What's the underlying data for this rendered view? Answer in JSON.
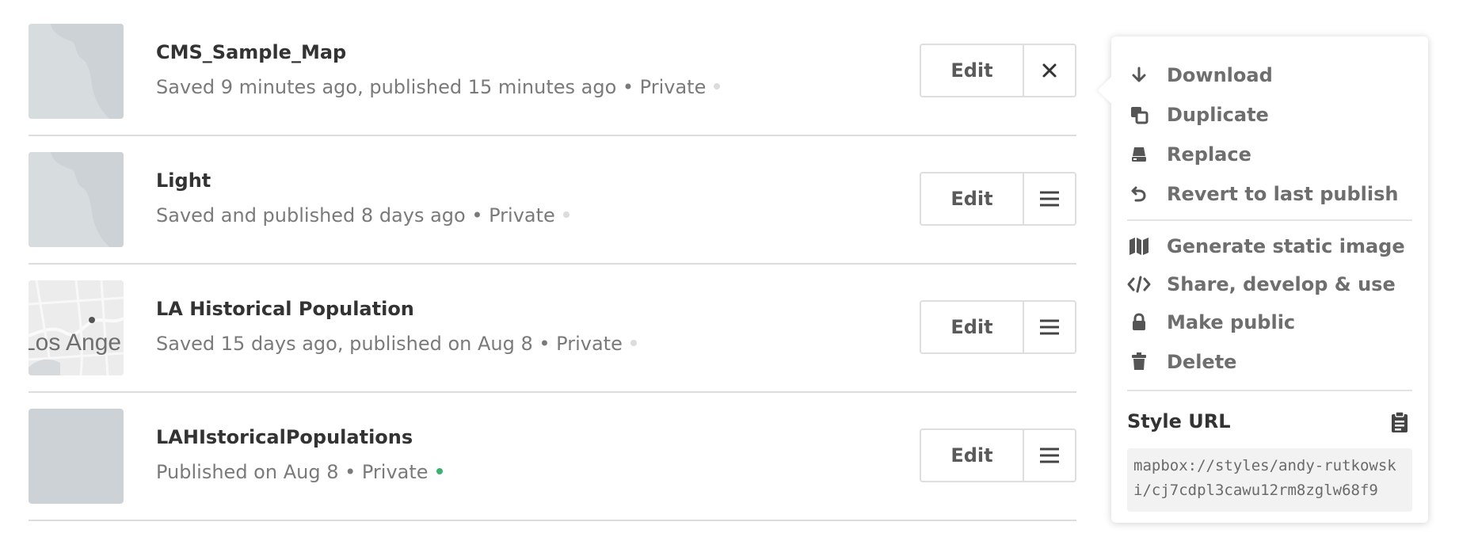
{
  "styles": [
    {
      "title": "CMS_Sample_Map",
      "meta": "Saved 9 minutes ago, published 15 minutes ago • Private",
      "published_dot": false,
      "thumbnail": "coastline",
      "edit_label": "Edit",
      "action_icon": "close-icon"
    },
    {
      "title": "Light",
      "meta": "Saved and published 8 days ago • Private",
      "published_dot": false,
      "thumbnail": "coastline",
      "edit_label": "Edit",
      "action_icon": "menu-icon"
    },
    {
      "title": "LA Historical Population",
      "meta": "Saved 15 days ago, published on Aug 8 • Private",
      "published_dot": false,
      "thumbnail": "streets",
      "thumbnail_label": "Los Ange",
      "edit_label": "Edit",
      "action_icon": "menu-icon"
    },
    {
      "title": "LAHIstoricalPopulations",
      "meta": "Published on Aug 8 • Private",
      "published_dot": true,
      "thumbnail": "blank",
      "edit_label": "Edit",
      "action_icon": "menu-icon"
    }
  ],
  "dropdown": {
    "items": [
      {
        "label": "Download",
        "icon": "download-icon"
      },
      {
        "label": "Duplicate",
        "icon": "duplicate-icon"
      },
      {
        "label": "Replace",
        "icon": "replace-icon"
      },
      {
        "label": "Revert to last publish",
        "icon": "revert-icon"
      },
      {
        "label": "Generate static image",
        "icon": "static-map-icon"
      },
      {
        "label": "Share, develop & use",
        "icon": "code-icon"
      },
      {
        "label": "Make public",
        "icon": "lock-icon"
      },
      {
        "label": "Delete",
        "icon": "trash-icon"
      }
    ],
    "style_url_label": "Style URL",
    "style_url": "mapbox://styles/andy-rutkowski/cj7cdpl3cawu12rm8zglw68f9"
  },
  "colors": {
    "published_dot": "#3bb272",
    "unpublished_dot": "#dcdcdc",
    "thumbnail_bg": "#ccd2d5"
  }
}
